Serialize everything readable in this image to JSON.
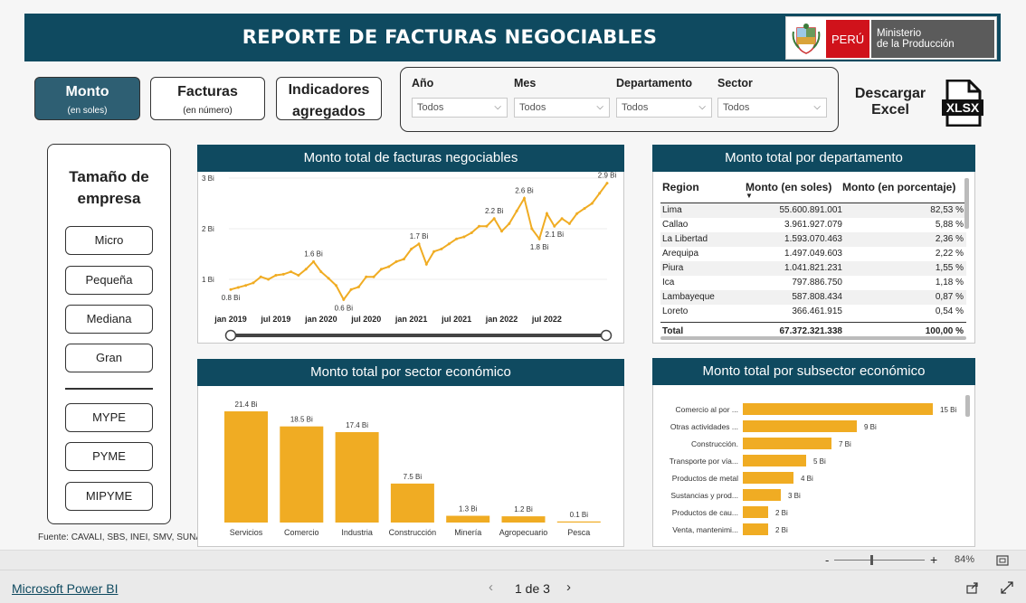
{
  "header": {
    "title": "REPORTE DE FACTURAS NEGOCIABLES",
    "logo_country": "PERÚ",
    "logo_ministry_line1": "Ministerio",
    "logo_ministry_line2": "de la Producción"
  },
  "tabs": [
    {
      "label": "Monto",
      "sub": "(en soles)"
    },
    {
      "label": "Facturas",
      "sub": "(en número)"
    },
    {
      "label": "Indicadores",
      "sub": "agregados"
    }
  ],
  "filters": [
    {
      "label": "Año",
      "value": "Todos"
    },
    {
      "label": "Mes",
      "value": "Todos"
    },
    {
      "label": "Departamento",
      "value": "Todos"
    },
    {
      "label": "Sector",
      "value": "Todos"
    }
  ],
  "download": {
    "line1": "Descargar",
    "line2": "Excel",
    "icon_text": "XLSX"
  },
  "company_size": {
    "title_line1": "Tamaño de",
    "title_line2": "empresa",
    "buttons": [
      "Micro",
      "Pequeña",
      "Mediana",
      "Gran",
      "MYPE",
      "PYME",
      "MIPYME"
    ]
  },
  "source": "Fuente: CAVALI, SBS, INEI, SMV, SUNAT",
  "colors": {
    "header": "#0f4a60",
    "accent": "#f0ac23",
    "active_tab": "#2e5f73"
  },
  "chart_data": [
    {
      "type": "line",
      "title": "Monto total de facturas negociables",
      "x_ticks": [
        "jan 2019",
        "jul 2019",
        "jan 2020",
        "jul 2020",
        "jan 2021",
        "jul 2021",
        "jan 2022",
        "jul 2022"
      ],
      "y_ticks": [
        "1 Bi",
        "2 Bi",
        "3 Bi"
      ],
      "ylim": [
        0.5,
        3.0
      ],
      "values": [
        0.8,
        0.84,
        0.88,
        0.93,
        1.05,
        1.0,
        1.08,
        1.1,
        1.15,
        1.08,
        1.2,
        1.35,
        1.15,
        1.02,
        0.88,
        0.6,
        0.8,
        0.85,
        1.05,
        1.05,
        1.2,
        1.25,
        1.35,
        1.4,
        1.6,
        1.7,
        1.3,
        1.55,
        1.6,
        1.7,
        1.8,
        1.84,
        1.92,
        2.05,
        2.05,
        2.2,
        1.95,
        2.1,
        2.35,
        2.6,
        2.0,
        1.8,
        2.3,
        2.05,
        2.2,
        2.1,
        2.3,
        2.4,
        2.5,
        2.7,
        2.9
      ],
      "data_labels": [
        {
          "index": 0,
          "text": "0.8 Bi",
          "pos": "below"
        },
        {
          "index": 11,
          "text": "1.6 Bi",
          "pos": "above"
        },
        {
          "index": 15,
          "text": "0.6 Bi",
          "pos": "below"
        },
        {
          "index": 25,
          "text": "1.7 Bi",
          "pos": "above"
        },
        {
          "index": 35,
          "text": "2.2 Bi",
          "pos": "above"
        },
        {
          "index": 39,
          "text": "2.6 Bi",
          "pos": "above"
        },
        {
          "index": 41,
          "text": "1.8 Bi",
          "pos": "below"
        },
        {
          "index": 43,
          "text": "2.1 Bi",
          "pos": "below"
        },
        {
          "index": 50,
          "text": "2.9 Bi",
          "pos": "above"
        }
      ]
    },
    {
      "type": "table",
      "title": "Monto total por departamento",
      "columns": [
        "Region",
        "Monto (en soles)",
        "Monto (en porcentaje)"
      ],
      "rows": [
        [
          "Lima",
          "55.600.891.001",
          "82,53 %"
        ],
        [
          "Callao",
          "3.961.927.079",
          "5,88 %"
        ],
        [
          "La Libertad",
          "1.593.070.463",
          "2,36 %"
        ],
        [
          "Arequipa",
          "1.497.049.603",
          "2,22 %"
        ],
        [
          "Piura",
          "1.041.821.231",
          "1,55 %"
        ],
        [
          "Ica",
          "797.886.750",
          "1,18 %"
        ],
        [
          "Lambayeque",
          "587.808.434",
          "0,87 %"
        ],
        [
          "Loreto",
          "366.461.915",
          "0,54 %"
        ]
      ],
      "total": [
        "Total",
        "67.372.321.338",
        "100,00 %"
      ]
    },
    {
      "type": "bar",
      "title": "Monto total por sector económico",
      "categories": [
        "Servicios",
        "Comercio",
        "Industria",
        "Construcción",
        "Minería",
        "Agropecuario",
        "Pesca"
      ],
      "values": [
        21.4,
        18.5,
        17.4,
        7.5,
        1.3,
        1.2,
        0.1
      ],
      "labels": [
        "21.4 Bi",
        "18.5 Bi",
        "17.4 Bi",
        "7.5 Bi",
        "1.3 Bi",
        "1.2 Bi",
        "0.1 Bi"
      ]
    },
    {
      "type": "bar",
      "orientation": "horizontal",
      "title": "Monto total por subsector económico",
      "categories": [
        "Comercio al por ...",
        "Otras actividades ...",
        "Construcción.",
        "Transporte por vía...",
        "Productos de metal",
        "Sustancias y prod...",
        "Productos de cau...",
        "Venta, mantenimi..."
      ],
      "values": [
        15,
        9,
        7,
        5,
        4,
        3,
        2,
        2
      ],
      "labels": [
        "15 Bi",
        "9 Bi",
        "7 Bi",
        "5 Bi",
        "4 Bi",
        "3 Bi",
        "2 Bi",
        "2 Bi"
      ]
    }
  ],
  "status": {
    "zoom": "84%",
    "minus": "-",
    "plus": "+"
  },
  "footer": {
    "brand": "Microsoft Power BI",
    "page": "1 de 3"
  }
}
